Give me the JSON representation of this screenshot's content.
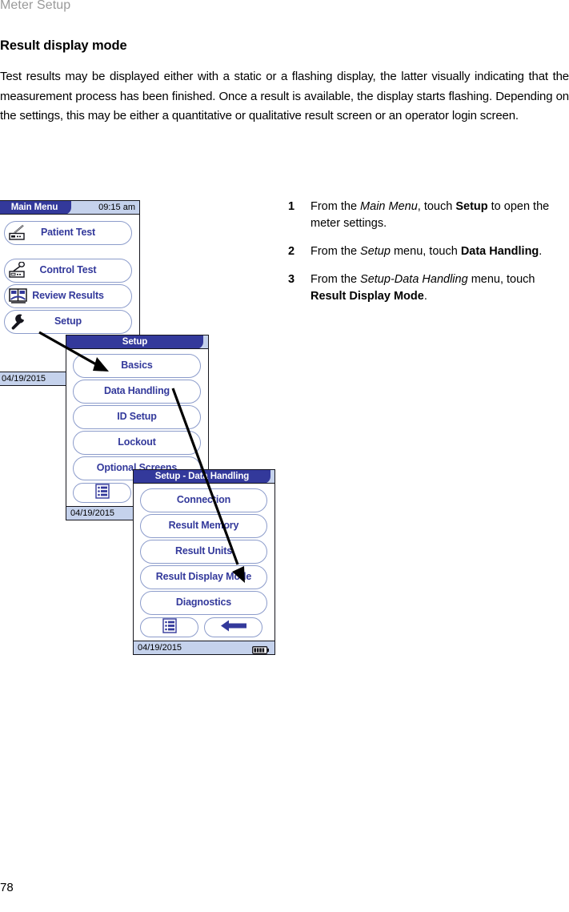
{
  "running_head": "Meter Setup",
  "section": {
    "title": "Result display mode",
    "paragraph": "Test results may be displayed either with a static or a flashing display, the latter visually indicating that the measurement process has been finished. Once a result is available, the display starts flashing. Depending on the settings, this may be either a quantitative or qualitative result screen or an operator login screen."
  },
  "steps": [
    {
      "number": "1",
      "parts": [
        {
          "text": "From the ",
          "style": "normal"
        },
        {
          "text": "Main Menu",
          "style": "italic"
        },
        {
          "text": ", touch ",
          "style": "normal"
        },
        {
          "text": "Setup",
          "style": "bold"
        },
        {
          "text": " to open the meter settings.",
          "style": "normal"
        }
      ]
    },
    {
      "number": "2",
      "parts": [
        {
          "text": "From the ",
          "style": "normal"
        },
        {
          "text": "Setup",
          "style": "italic"
        },
        {
          "text": " menu, touch ",
          "style": "normal"
        },
        {
          "text": "Data Handling",
          "style": "bold"
        },
        {
          "text": ".",
          "style": "normal"
        }
      ]
    },
    {
      "number": "3",
      "parts": [
        {
          "text": "From the ",
          "style": "normal"
        },
        {
          "text": "Setup-Data Handling",
          "style": "italic"
        },
        {
          "text": " menu, touch ",
          "style": "normal"
        },
        {
          "text": "Result Display Mode",
          "style": "bold"
        },
        {
          "text": ".",
          "style": "normal"
        }
      ]
    }
  ],
  "screens": {
    "main_menu": {
      "title": "Main Menu",
      "clock": "09:15 am",
      "date": "04/19/2015",
      "buttons": [
        {
          "label": "Patient Test",
          "icon": "lancet-meter-icon"
        },
        {
          "label": "Control Test",
          "icon": "control-vial-meter-icon"
        },
        {
          "label": "Review Results",
          "icon": "open-book-icon"
        },
        {
          "label": "Setup",
          "icon": "wrench-icon"
        }
      ]
    },
    "setup": {
      "title": "Setup",
      "date": "04/19/2015",
      "buttons": [
        {
          "label": "Basics"
        },
        {
          "label": "Data Handling"
        },
        {
          "label": "ID Setup"
        },
        {
          "label": "Lockout"
        },
        {
          "label": "Optional Screens"
        }
      ],
      "footer_icon": "records-list-icon"
    },
    "setup_data_handling": {
      "title": "Setup - Data Handling",
      "date": "04/19/2015",
      "buttons": [
        {
          "label": "Connection"
        },
        {
          "label": "Result Memory"
        },
        {
          "label": "Result Units"
        },
        {
          "label": "Result Display Mode"
        },
        {
          "label": "Diagnostics"
        }
      ],
      "footer_icons": [
        "records-list-icon",
        "back-arrow-icon"
      ],
      "battery_icon": "battery-full-icon"
    }
  },
  "page_number": "78",
  "colors": {
    "header_blue": "#33399b",
    "header_light": "#c5d2ec",
    "button_border": "#8c9ccb",
    "text_blue": "#33399b",
    "running_head": "#9a9a9a"
  }
}
